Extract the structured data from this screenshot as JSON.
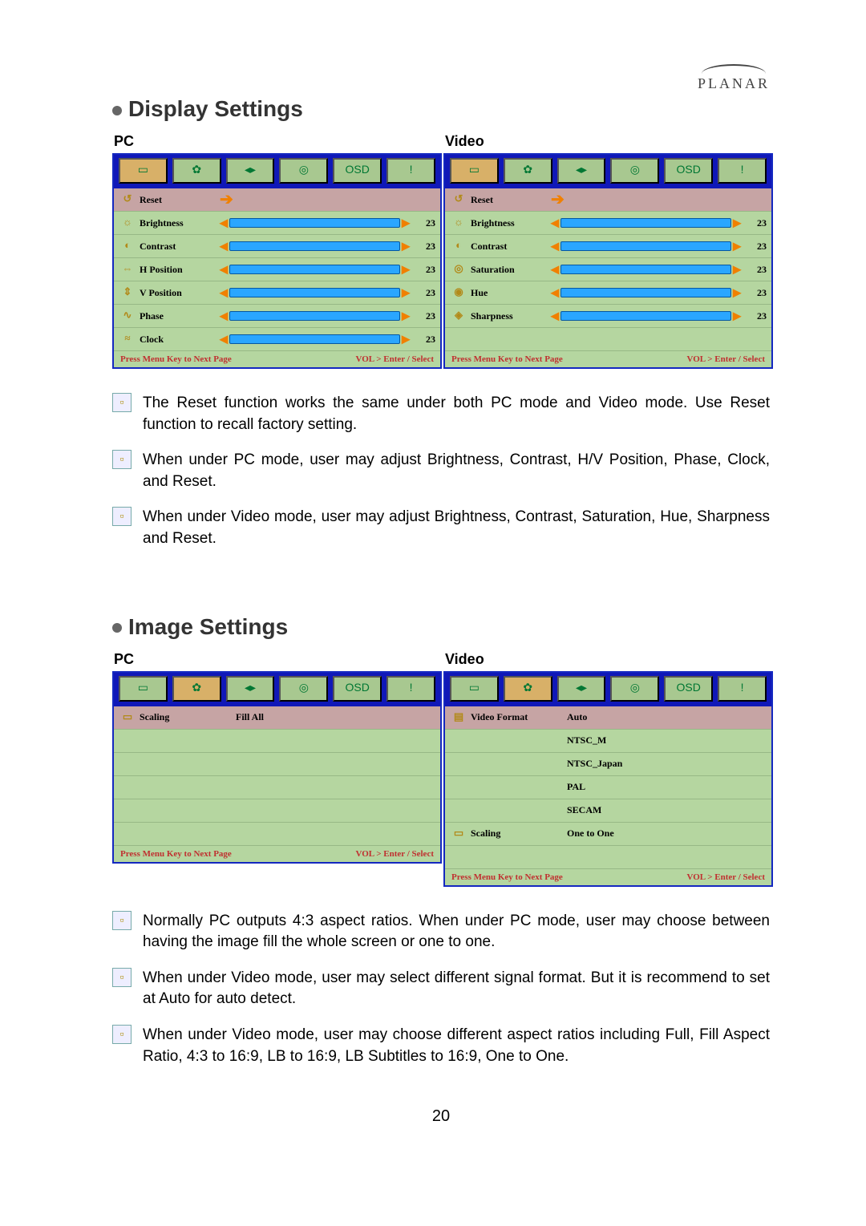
{
  "brand": "PLANAR",
  "page_number": "20",
  "sections": {
    "display": {
      "title": "Display Settings",
      "pc_label": "PC",
      "video_label": "Video",
      "pc_rows": [
        {
          "icon": "↺",
          "label": "Reset",
          "type": "arrow"
        },
        {
          "icon": "☼",
          "label": "Brightness",
          "type": "slider",
          "value": "23"
        },
        {
          "icon": "◐",
          "label": "Contrast",
          "type": "slider",
          "value": "23"
        },
        {
          "icon": "⇔",
          "label": "H Position",
          "type": "slider",
          "value": "23"
        },
        {
          "icon": "⇕",
          "label": "V Position",
          "type": "slider",
          "value": "23"
        },
        {
          "icon": "∿",
          "label": "Phase",
          "type": "slider",
          "value": "23"
        },
        {
          "icon": "≈",
          "label": "Clock",
          "type": "slider",
          "value": "23"
        }
      ],
      "video_rows": [
        {
          "icon": "↺",
          "label": "Reset",
          "type": "arrow"
        },
        {
          "icon": "☼",
          "label": "Brightness",
          "type": "slider",
          "value": "23"
        },
        {
          "icon": "◐",
          "label": "Contrast",
          "type": "slider",
          "value": "23"
        },
        {
          "icon": "◎",
          "label": "Saturation",
          "type": "slider",
          "value": "23"
        },
        {
          "icon": "◉",
          "label": "Hue",
          "type": "slider",
          "value": "23"
        },
        {
          "icon": "◈",
          "label": "Sharpness",
          "type": "slider",
          "value": "23"
        }
      ],
      "footer_left": "Press Menu Key to Next Page",
      "footer_right": "VOL > Enter / Select"
    },
    "image": {
      "title": "Image Settings",
      "pc_label": "PC",
      "video_label": "Video",
      "pc_rows": [
        {
          "icon": "▭",
          "label": "Scaling",
          "value": "Fill All",
          "alt": true
        },
        {
          "type": "pad"
        },
        {
          "type": "pad"
        },
        {
          "type": "pad"
        },
        {
          "type": "pad"
        },
        {
          "type": "pad"
        }
      ],
      "video_rows": [
        {
          "icon": "▤",
          "label": "Video Format",
          "value": "Auto",
          "alt": true
        },
        {
          "label": "",
          "value": "NTSC_M"
        },
        {
          "label": "",
          "value": "NTSC_Japan"
        },
        {
          "label": "",
          "value": "PAL"
        },
        {
          "label": "",
          "value": "SECAM"
        },
        {
          "icon": "▭",
          "label": "Scaling",
          "value": "One to One"
        }
      ],
      "footer_left": "Press Menu Key to Next Page",
      "footer_right": "VOL > Enter / Select"
    }
  },
  "bullets_display": [
    "The Reset function works the same under both PC mode and Video mode. Use Reset function to recall factory setting.",
    "When under PC mode, user may adjust Brightness, Contrast, H/V Position, Phase, Clock, and Reset.",
    "When under Video mode, user may adjust Brightness, Contrast, Saturation, Hue, Sharpness and Reset."
  ],
  "bullets_image": [
    "Normally PC outputs 4:3 aspect ratios. When under PC mode, user may choose between having the image fill the whole screen or one to one.",
    "When under Video mode, user may select different signal format. But it is recommend to set at Auto for auto detect.",
    "When under Video mode, user may choose different aspect ratios including Full, Fill Aspect Ratio, 4:3 to 16:9, LB to 16:9, LB Subtitles to 16:9, One to One."
  ],
  "tab_icons": [
    "▭",
    "✿",
    "◂▸",
    "◎",
    "OSD",
    "!"
  ]
}
